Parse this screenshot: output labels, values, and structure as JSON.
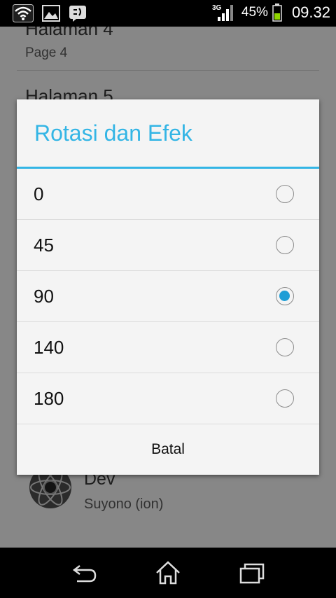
{
  "status_bar": {
    "network": "3G",
    "battery_percent": "45%",
    "time": "09.32",
    "icons": [
      "wifi-icon",
      "image-icon",
      "bbm-icon",
      "signal-icon",
      "battery-icon"
    ]
  },
  "background_list": {
    "items": [
      {
        "title": "Halaman 4",
        "subtitle": "Page 4"
      },
      {
        "title": "Halaman 5",
        "subtitle": ""
      }
    ],
    "footer_item": {
      "title": "Dev",
      "subtitle": "Suyono (ion)"
    }
  },
  "dialog": {
    "title": "Rotasi dan Efek",
    "options": [
      {
        "label": "0",
        "checked": false
      },
      {
        "label": "45",
        "checked": false
      },
      {
        "label": "90",
        "checked": true
      },
      {
        "label": "140",
        "checked": false
      },
      {
        "label": "180",
        "checked": false
      }
    ],
    "cancel_label": "Batal"
  },
  "colors": {
    "accent": "#33b5e5",
    "radio_checked": "#1f9ed6"
  }
}
